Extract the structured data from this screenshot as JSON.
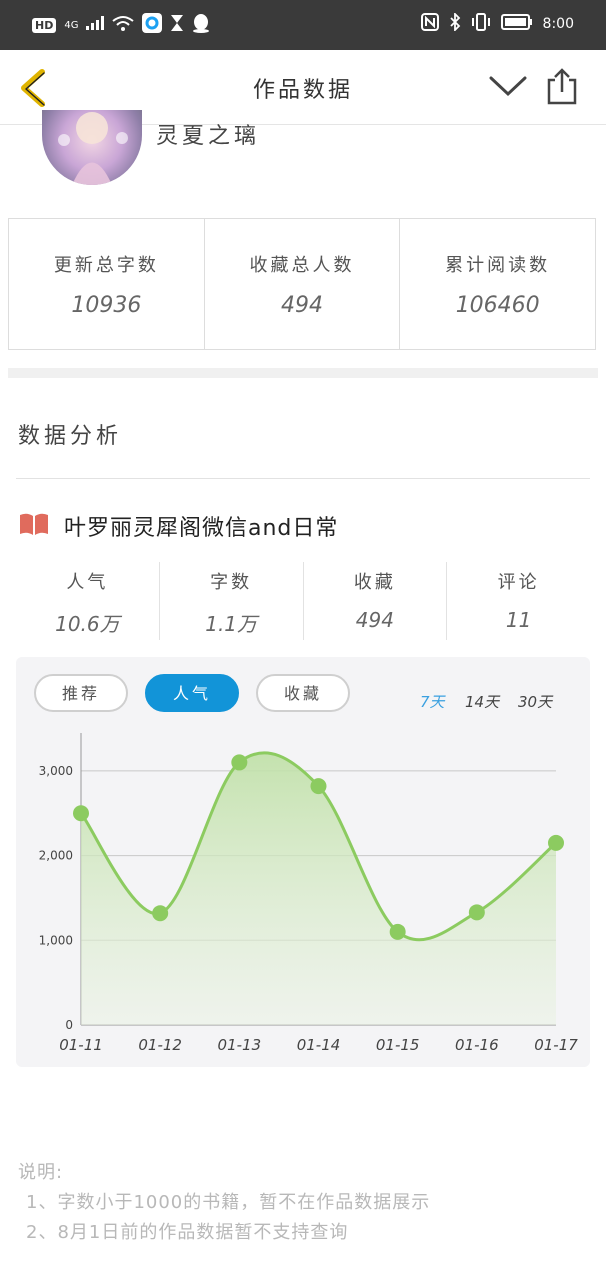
{
  "status_bar": {
    "hd": "HD",
    "network": "4G",
    "time": "8:00"
  },
  "header": {
    "title": "作品数据"
  },
  "author": {
    "name": "灵夏之璃"
  },
  "summary": [
    {
      "label": "更新总字数",
      "value": "10936"
    },
    {
      "label": "收藏总人数",
      "value": "494"
    },
    {
      "label": "累计阅读数",
      "value": "106460"
    }
  ],
  "analysis": {
    "title": "数据分析"
  },
  "book": {
    "title": "叶罗丽灵犀阁微信and日常",
    "metrics": [
      {
        "label": "人气",
        "value": "10.6万"
      },
      {
        "label": "字数",
        "value": "1.1万"
      },
      {
        "label": "收藏",
        "value": "494"
      },
      {
        "label": "评论",
        "value": "11"
      }
    ]
  },
  "chart_controls": {
    "tabs": [
      {
        "label": "推荐",
        "active": false
      },
      {
        "label": "人气",
        "active": true
      },
      {
        "label": "收藏",
        "active": false
      }
    ],
    "periods": [
      {
        "label": "7天",
        "active": true
      },
      {
        "label": "14天",
        "active": false
      },
      {
        "label": "30天",
        "active": false
      }
    ]
  },
  "chart_data": {
    "type": "area",
    "categories": [
      "01-11",
      "01-12",
      "01-13",
      "01-14",
      "01-15",
      "01-16",
      "01-17"
    ],
    "values": [
      2500,
      1320,
      3100,
      2820,
      1100,
      1330,
      2150
    ],
    "yticks": [
      "0",
      "1,000",
      "2,000",
      "3,000"
    ],
    "ylim": [
      0,
      3400
    ],
    "grid": true,
    "line_color": "#8ccb60",
    "fill_color": "#cfe8bd"
  },
  "notes": {
    "heading": "说明:",
    "items": [
      "1、字数小于1000的书籍，暂不在作品数据展示",
      "2、8月1日前的作品数据暂不支持查询"
    ]
  },
  "colors": {
    "accent": "#1294d8",
    "book_icon": "#e06b5d"
  }
}
